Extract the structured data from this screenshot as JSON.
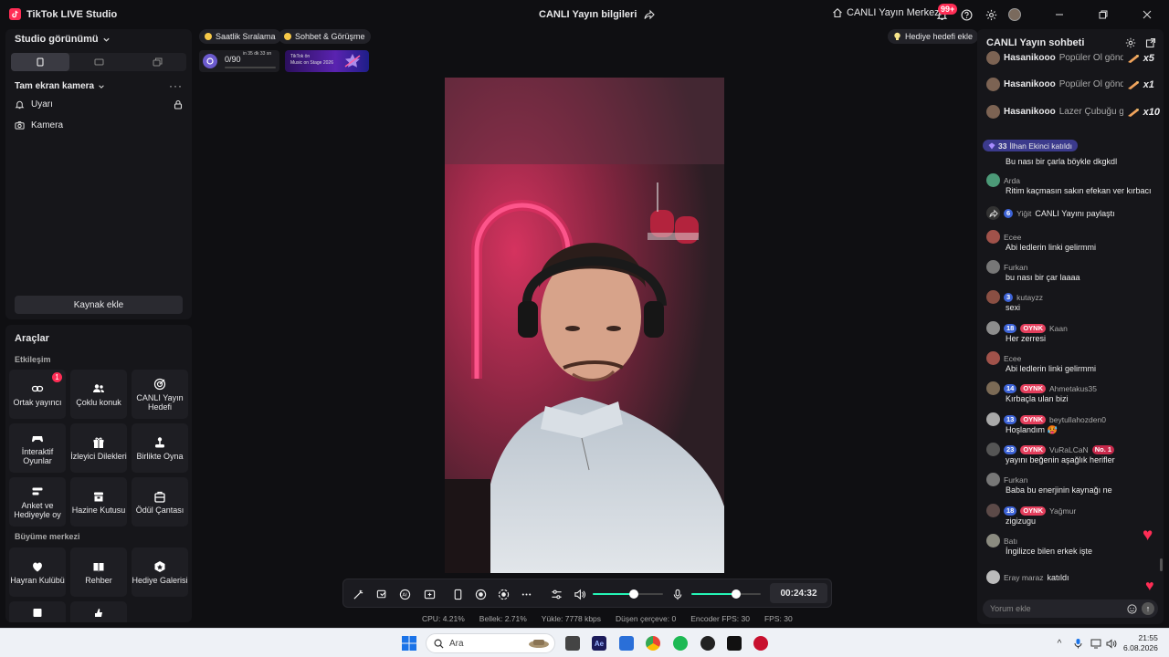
{
  "app": {
    "title": "TikTok LIVE Studio",
    "center_title": "CANLI Yayın bilgileri",
    "live_center": "CANLI Yayın Merkezi",
    "notifications": "99+"
  },
  "left": {
    "studio_view": "Studio görünümü",
    "scene": "Tam ekran kamera",
    "sources": [
      {
        "label": "Uyarı",
        "icon": "bell-icon"
      },
      {
        "label": "Kamera",
        "icon": "camera-icon"
      }
    ],
    "add_source": "Kaynak ekle"
  },
  "tools": {
    "title": "Araçlar",
    "section_engagement": "Etkileşim",
    "section_growth": "Büyüme merkezi",
    "engagement": [
      {
        "label": "Ortak yayıncı",
        "icon": "link-icon",
        "badge": "1"
      },
      {
        "label": "Çoklu konuk",
        "icon": "users-icon"
      },
      {
        "label": "CANLI Yayın Hedefi",
        "icon": "target-icon"
      },
      {
        "label": "İnteraktif Oyunlar",
        "icon": "gamepad-icon"
      },
      {
        "label": "İzleyici Dilekleri",
        "icon": "gift-icon"
      },
      {
        "label": "Birlikte Oyna",
        "icon": "joystick-icon"
      },
      {
        "label": "Anket ve Hediyeyle oy",
        "icon": "poll-icon"
      },
      {
        "label": "Hazine Kutusu",
        "icon": "treasure-icon"
      },
      {
        "label": "Ödül Çantası",
        "icon": "bag-icon"
      }
    ],
    "growth": [
      {
        "label": "Hayran Kulübü",
        "icon": "heart-shield-icon"
      },
      {
        "label": "Rehber",
        "icon": "book-icon"
      },
      {
        "label": "Hediye Galerisi",
        "icon": "gallery-icon"
      }
    ]
  },
  "center": {
    "pill_ranking": "Saatlik Sıralama",
    "pill_chat": "Sohbet & Görüşme",
    "gift_goal": "Hediye hedefi ekle",
    "goal_progress": "0/90",
    "goal_progress_fraction": 0.0,
    "goal_time": "in 35 dk 33 sn",
    "promo_line1": "TikTok ön",
    "promo_line2": "Music on Stage 2026",
    "timer": "00:24:32",
    "speaker_volume": 0.58,
    "mic_volume": 0.65
  },
  "stats": [
    {
      "label": "CPU:",
      "value": "4.21%"
    },
    {
      "label": "Bellek:",
      "value": "2.71%"
    },
    {
      "label": "Yükle:",
      "value": "7778 kbps"
    },
    {
      "label": "Düşen çerçeve:",
      "value": "0"
    },
    {
      "label": "Encoder FPS:",
      "value": "30"
    },
    {
      "label": "FPS:",
      "value": "30"
    }
  ],
  "chat": {
    "title": "CANLI Yayın sohbeti",
    "gifts": [
      {
        "user": "Hasanikooo",
        "text": "Popüler Ol gönde",
        "count": "x5",
        "icon": "rocket-gift-icon"
      },
      {
        "user": "Hasanikooo",
        "text": "Popüler Ol gönde",
        "count": "x1",
        "icon": "rocket-gift-icon"
      },
      {
        "user": "Hasanikooo",
        "text": "Lazer Çubuğu g",
        "count": "x10",
        "icon": "laser-gift-icon"
      }
    ],
    "join": {
      "level": "33",
      "text": "İlhan Ekinci katıldı"
    },
    "messages": [
      {
        "user": "",
        "text": "Bu nası bir çarla böykle dkgkdl",
        "level": "",
        "fan": "",
        "color": "#6b5a50"
      },
      {
        "user": "Arda",
        "text": "Ritim kaçmasın sakın efekan ver kırbacı",
        "level": "",
        "fan": "",
        "color": "#4c9a78"
      },
      {
        "user": "Yiğit",
        "text": "CANLI Yayını paylaştı",
        "level": "6",
        "fan": "",
        "color": "share",
        "inline": true
      },
      {
        "user": "Ecee",
        "text": "Abi ledlerin linki gelirmmi",
        "level": "",
        "fan": "",
        "color": "#a0524a"
      },
      {
        "user": "Furkan",
        "text": "bu nası bir çar laaaa",
        "level": "",
        "fan": "",
        "color": "#777"
      },
      {
        "user": "kutayzz",
        "text": "sexi",
        "level": "3",
        "fan": "",
        "color": "#8a4f43"
      },
      {
        "user": "Kaan",
        "text": "Her zerresi",
        "level": "18",
        "fan": "OYNK",
        "color": "#8d8d8d"
      },
      {
        "user": "Ecee",
        "text": "Abi ledlerin linki gelirmmi",
        "level": "",
        "fan": "",
        "color": "#a0524a"
      },
      {
        "user": "Ahmetakus35",
        "text": "Kırbaçla ulan bizi",
        "level": "14",
        "fan": "OYNK",
        "color": "#7b6a55"
      },
      {
        "user": "beytullahozden0",
        "text": "Hoşlandım 🥵",
        "level": "13",
        "fan": "OYNK",
        "color": "#a9a9a9"
      },
      {
        "user": "VuRaLCaN",
        "text": "yayını beğenin aşağlık herifler",
        "level": "23",
        "fan": "OYNK",
        "rank": "No. 1",
        "color": "#555"
      },
      {
        "user": "Furkan",
        "text": "Baba bu enerjinin kaynağı ne",
        "level": "",
        "fan": "",
        "color": "#777"
      },
      {
        "user": "Yağmur",
        "text": "zigizugu",
        "level": "18",
        "fan": "OYNK",
        "color": "#5c4a48"
      },
      {
        "user": "Batı",
        "text": "İngilizce bilen erkek işte",
        "level": "",
        "fan": "",
        "color": "#8b8b80"
      },
      {
        "user": "Eray maraz",
        "text": "katıldı",
        "level": "",
        "fan": "",
        "color": "#bbb",
        "inline": true
      }
    ],
    "placeholder": "Yorum ekle"
  },
  "taskbar": {
    "search": "Ara",
    "time": "21:55",
    "date": "6.08.2026"
  }
}
